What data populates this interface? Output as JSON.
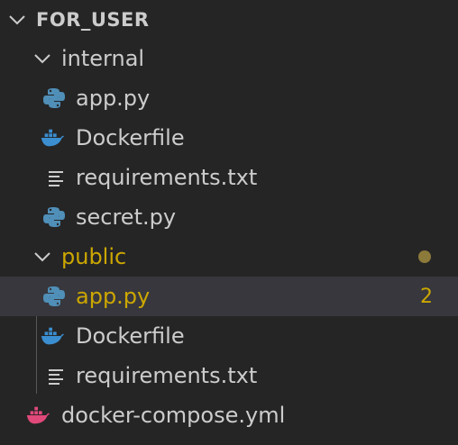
{
  "explorer": {
    "root": {
      "label": "FOR_USER",
      "icon": "chevron-down-icon"
    },
    "internal": {
      "label": "internal",
      "files": [
        {
          "label": "app.py",
          "icon": "python-icon"
        },
        {
          "label": "Dockerfile",
          "icon": "docker-icon"
        },
        {
          "label": "requirements.txt",
          "icon": "text-file-icon"
        },
        {
          "label": "secret.py",
          "icon": "python-icon"
        }
      ]
    },
    "public": {
      "label": "public",
      "files": [
        {
          "label": "app.py",
          "icon": "python-icon",
          "badge": "2"
        },
        {
          "label": "Dockerfile",
          "icon": "docker-icon"
        },
        {
          "label": "requirements.txt",
          "icon": "text-file-icon"
        }
      ]
    },
    "compose": {
      "label": "docker-compose.yml",
      "icon": "docker-compose-icon"
    }
  },
  "colors": {
    "background": "#252526",
    "text": "#cccccc",
    "modified": "#cca700",
    "selection": "#37373d",
    "python": "#4f8fb8",
    "docker": "#3b8ed0",
    "compose": "#e0497a"
  }
}
